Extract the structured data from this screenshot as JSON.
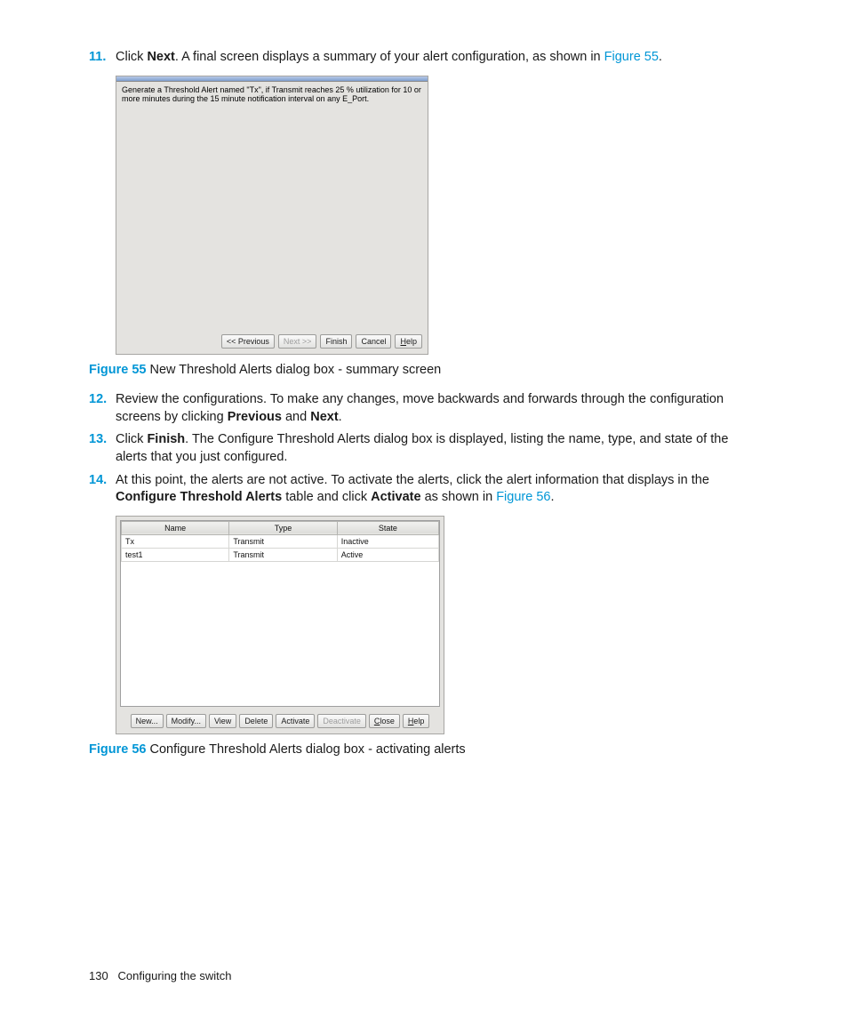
{
  "step11": {
    "num": "11.",
    "t1": "Click ",
    "b1": "Next",
    "t2": ". A final screen displays a summary of your alert configuration, as shown in ",
    "link": "Figure 55",
    "t3": "."
  },
  "fig55": {
    "summary": "Generate a Threshold Alert named \"Tx\", if Transmit reaches 25 % utilization for 10 or more minutes during the 15 minute notification interval on any E_Port.",
    "buttons": {
      "prev": "<< Previous",
      "next": "Next >>",
      "finish": "Finish",
      "cancel": "Cancel",
      "help_u": "H",
      "help_rest": "elp"
    },
    "cap_label": "Figure 55",
    "cap_text": " New Threshold Alerts dialog box - summary screen"
  },
  "step12": {
    "num": "12.",
    "t1": "Review the configurations. To make any changes, move backwards and forwards through the configuration screens by clicking ",
    "b1": "Previous",
    "t2": " and ",
    "b2": "Next",
    "t3": "."
  },
  "step13": {
    "num": "13.",
    "t1": "Click ",
    "b1": "Finish",
    "t2": ". The Configure Threshold Alerts dialog box is displayed, listing the name, type, and state of the alerts that you just configured."
  },
  "step14": {
    "num": "14.",
    "t1": "At this point, the alerts are not active. To activate the alerts, click the alert information that displays in the ",
    "b1": "Configure Threshold Alerts",
    "t2": " table and click ",
    "b2": "Activate",
    "t3": " as shown in ",
    "link": "Figure 56",
    "t4": "."
  },
  "fig56": {
    "headers": {
      "name": "Name",
      "type": "Type",
      "state": "State"
    },
    "rows": [
      {
        "name": "Tx",
        "type": "Transmit",
        "state": "Inactive"
      },
      {
        "name": "test1",
        "type": "Transmit",
        "state": "Active"
      }
    ],
    "buttons": {
      "new": "New...",
      "modify": "Modify...",
      "view": "View",
      "delete": "Delete",
      "activate": "Activate",
      "deactivate": "Deactivate",
      "close_u": "C",
      "close_rest": "lose",
      "help_u": "H",
      "help_rest": "elp"
    },
    "cap_label": "Figure 56",
    "cap_text": " Configure Threshold Alerts dialog box - activating alerts"
  },
  "footer": {
    "page": "130",
    "section": "Configuring the switch"
  }
}
